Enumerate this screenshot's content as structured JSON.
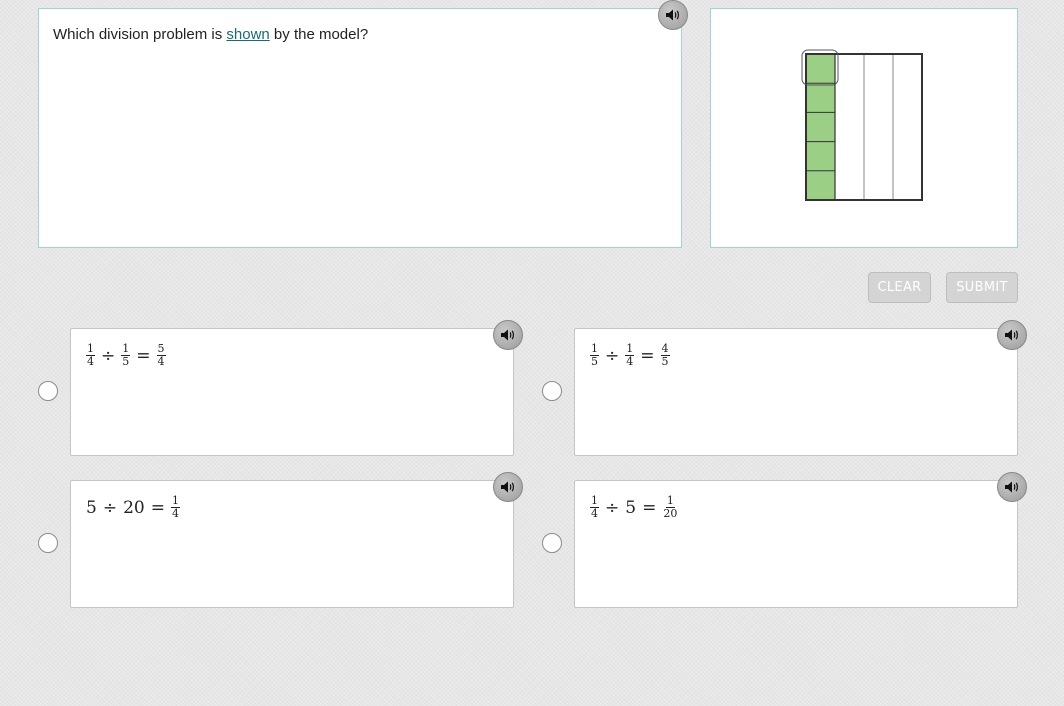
{
  "question": {
    "prefix": "Which division problem is ",
    "link": "shown",
    "suffix": " by the model?"
  },
  "model": {
    "rows": 5,
    "columns": 4,
    "shaded_cells": "column 1, all 5 rows",
    "fill_color": "#9ccf86",
    "highlighted_cell": "column 1, row 1"
  },
  "buttons": {
    "clear": "CLEAR",
    "submit": "SUBMIT"
  },
  "choices": [
    {
      "a": {
        "num": "1",
        "den": "4"
      },
      "op": "÷",
      "b": {
        "num": "1",
        "den": "5"
      },
      "eq": "=",
      "result": {
        "num": "5",
        "den": "4"
      }
    },
    {
      "a": {
        "num": "1",
        "den": "5"
      },
      "op": "÷",
      "b": {
        "num": "1",
        "den": "4"
      },
      "eq": "=",
      "result": {
        "num": "4",
        "den": "5"
      }
    },
    {
      "a_whole": "5",
      "op": "÷",
      "b_whole": "20",
      "eq": "=",
      "result": {
        "num": "1",
        "den": "4"
      }
    },
    {
      "a": {
        "num": "1",
        "den": "4"
      },
      "op": "÷",
      "b_whole": "5",
      "eq": "=",
      "result": {
        "num": "1",
        "den": "20"
      }
    }
  ],
  "icons": {
    "audio": "speaker-icon",
    "radio": "radio-unselected"
  }
}
